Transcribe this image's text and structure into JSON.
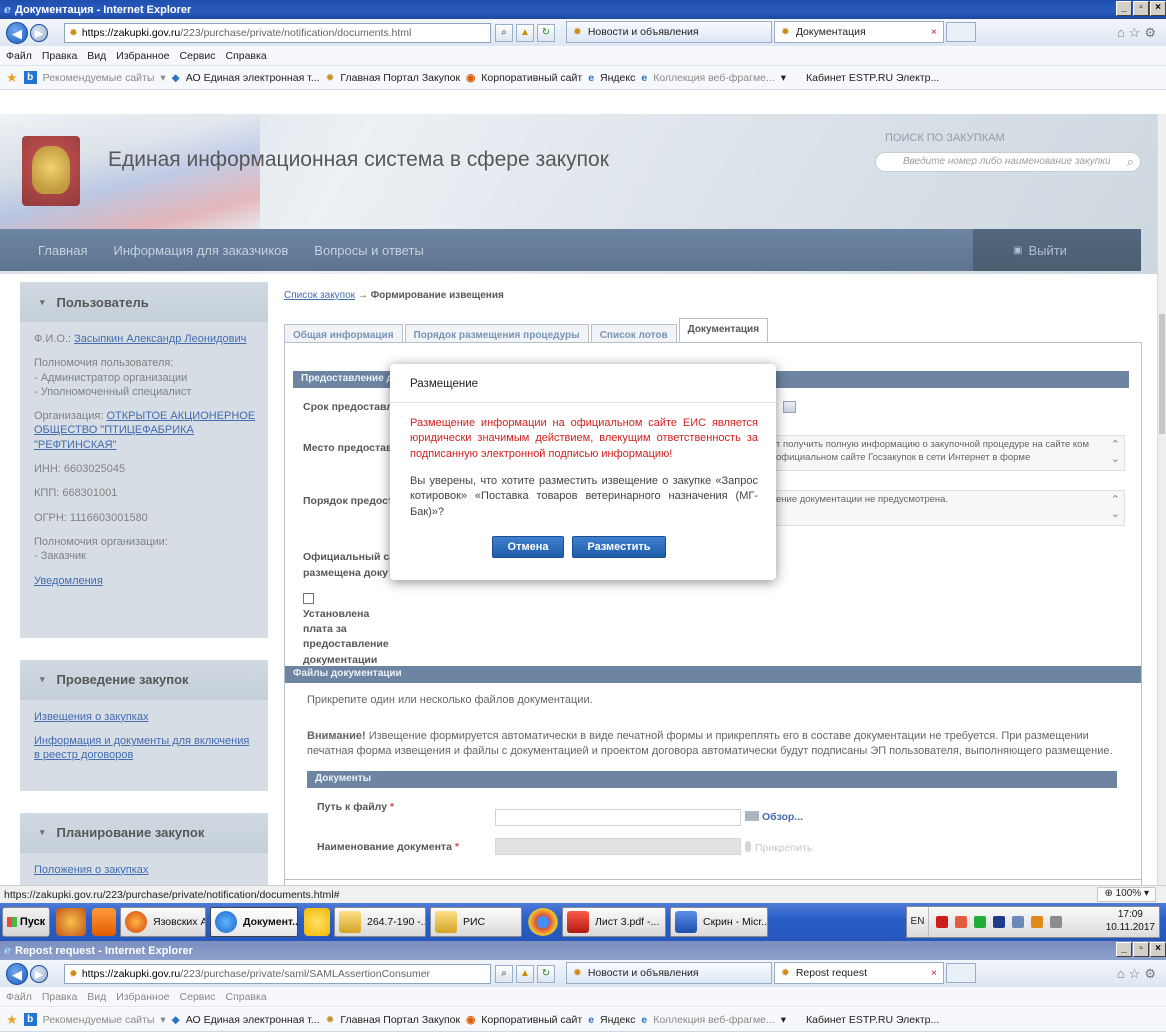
{
  "window1": {
    "title": "Документация - Internet Explorer",
    "url_host": "https://zakupki.gov.ru",
    "url_path": "/223/purchase/private/notification/documents.html",
    "tabs": [
      {
        "label": "Новости и объявления"
      },
      {
        "label": "Документация"
      }
    ],
    "menu": [
      "Файл",
      "Правка",
      "Вид",
      "Избранное",
      "Сервис",
      "Справка"
    ],
    "favorites": {
      "recommended": "Рекомендуемые сайты",
      "ao": "АО Единая электронная т...",
      "main": "Главная Портал Закупок",
      "corp": "Корпоративный сайт",
      "yandex": "Яндекс",
      "collection": "Коллекция веб-фрагме...",
      "cabinet": "Кабинет ESTP.RU Электр..."
    }
  },
  "site": {
    "title": "Единая информационная система в сфере закупок",
    "search_label": "ПОИСК ПО ЗАКУПКАМ",
    "search_placeholder": "Введите номер либо наименование закупки",
    "nav": [
      "Главная",
      "Информация для заказчиков",
      "Вопросы и ответы"
    ],
    "logout": "Выйти"
  },
  "sidebar": {
    "user_header": "Пользователь",
    "fio_label": "Ф.И.О.:",
    "fio_value": "Засыпкин Александр Леонидович",
    "powers_label": "Полномочия пользователя:",
    "powers": [
      "- Администратор организации",
      "- Уполномоченный специалист"
    ],
    "org_label": "Организация:",
    "org_value": "ОТКРЫТОЕ АКЦИОНЕРНОЕ ОБЩЕСТВО \"ПТИЦЕФАБРИКА \"РЕФТИНСКАЯ\"",
    "inn": "ИНН: 6603025045",
    "kpp": "КПП: 668301001",
    "ogrn": "ОГРН: 1116603001580",
    "org_powers_label": "Полномочия организации:",
    "org_powers": "- Заказчик",
    "notifications": "Уведомления",
    "conduct_header": "Проведение закупок",
    "conduct_links": [
      "Извещения о закупках",
      "Информация и документы для включения в реестр договоров"
    ],
    "plan_header": "Планирование закупок",
    "plan_links": [
      "Положения о закупках"
    ]
  },
  "main": {
    "breadcrumb_link": "Список закупок",
    "breadcrumb_arrow": "→",
    "breadcrumb_current": "Формирование извещения",
    "tabs": [
      "Общая информация",
      "Порядок размещения процедуры",
      "Список лотов",
      "Документация"
    ],
    "section1": "Предоставление д",
    "field_term": "Срок предоставл",
    "field_place": "Место предостав",
    "place_text": "т получить полную информацию о закупочной процедуре на сайте ком официальном сайте Госзакупок в сети  Интернет в форме",
    "field_order": "Порядок предост",
    "order_text": "ение документации не предусмотрена.",
    "field_official": "Официальный са",
    "field_official2": "размещена доку",
    "fee_label": "Установлена плата за предоставление документации",
    "section_files": "Файлы документации",
    "attach_hint": "Прикрепите один или несколько файлов документации.",
    "attention_bold": "Внимание!",
    "attention_text": " Извещение формируется автоматически в виде печатной формы и прикреплять его в составе документации не требуется. При размещении печатная форма извещения и файлы с документацией и проектом договора автоматически будут подписаны ЭП пользователя, выполняющего размещение.",
    "section_docs": "Документы",
    "file_path_label": "Путь к файлу",
    "doc_name_label": "Наименование документа",
    "required_mark": "*",
    "browse": "Обзор...",
    "attach": "Прикрепить"
  },
  "modal": {
    "title": "Размещение",
    "warning": "Размещение информации на официальном сайте ЕИС является юридически значимым действием, влекущим ответственность за подписанную электронной подписью информацию!",
    "question": "Вы уверены, что хотите разместить извещение о закупке «Запрос котировок» «Поставка товаров ветеринарного назначения (МГ-Бак)»?",
    "cancel": "Отмена",
    "confirm": "Разместить"
  },
  "statusbar": {
    "url": "https://zakupki.gov.ru/223/purchase/private/notification/documents.html#",
    "zoom": "100%"
  },
  "taskbar": {
    "start": "Пуск",
    "items": [
      "Язовских Ан...",
      "Документ...",
      "264.7-190 -...",
      "РИС",
      "Лист 3.pdf -...",
      "Скрин - Micr..."
    ],
    "lang": "EN",
    "time": "17:09",
    "date": "10.11.2017"
  },
  "window2": {
    "title": "Repost request - Internet Explorer",
    "url_host": "https://zakupki.gov.ru",
    "url_path": "/223/purchase/private/saml/SAMLAssertionConsumer",
    "tabs": [
      {
        "label": "Новости и объявления"
      },
      {
        "label": "Repost request"
      }
    ]
  },
  "colors": {
    "nav": "#3a5677",
    "section": "#4d6b8e",
    "button": "#1e5ea8",
    "warning": "#d21f1f"
  }
}
